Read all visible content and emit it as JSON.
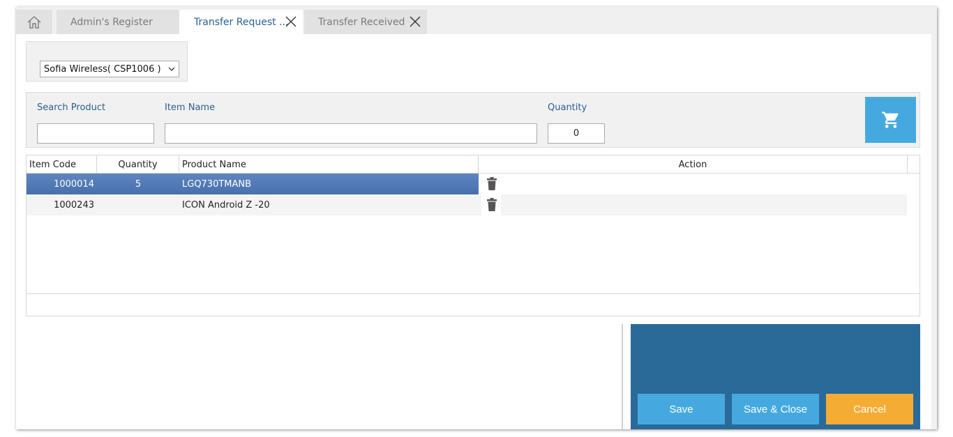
{
  "tabs": {
    "admin_label": "Admin's Register",
    "transfer_label": "Transfer Request ...",
    "received_label": "Transfer Received"
  },
  "store": {
    "selected": "Sofia Wireless( CSP1006 )"
  },
  "search": {
    "search_product_label": "Search Product",
    "item_name_label": "Item Name",
    "quantity_label": "Quantity",
    "search_product_value": "",
    "item_name_value": "",
    "quantity_value": "0"
  },
  "grid": {
    "columns": {
      "item_code": "Item Code",
      "quantity": "Quantity",
      "product_name": "Product Name",
      "action": "Action"
    },
    "rows": [
      {
        "item_code": "1000014",
        "quantity": "5",
        "product_name": "LGQ730TMANB",
        "selected": true
      },
      {
        "item_code": "1000243",
        "quantity": "",
        "product_name": "ICON Android Z -20",
        "selected": false
      }
    ]
  },
  "actions": {
    "save_label": "Save",
    "save_close_label": "Save & Close",
    "cancel_label": "Cancel"
  },
  "colors": {
    "accent": "#45a9e0",
    "panel": "#2a6a98",
    "cancel": "#f5ac35",
    "selected_row": "#4f78b5",
    "label_blue": "#2a5f90"
  },
  "icons": {
    "home": "home-icon",
    "close": "close-icon",
    "cart": "cart-icon",
    "trash": "trash-icon",
    "dropdown": "chevron-down-icon"
  }
}
